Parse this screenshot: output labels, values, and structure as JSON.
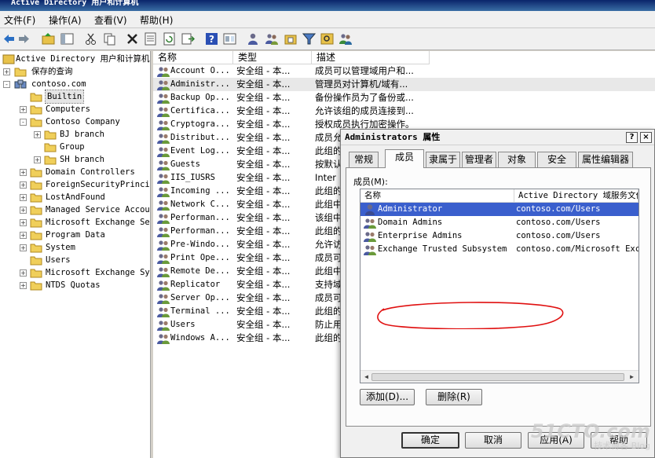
{
  "window": {
    "title": "Active Directory 用户和计算机"
  },
  "menu": [
    "文件(F)",
    "操作(A)",
    "查看(V)",
    "帮助(H)"
  ],
  "toolbar_icons": [
    "back-icon",
    "forward-icon",
    "up-folder-icon",
    "show-tree-icon",
    "cut-icon",
    "copy-icon",
    "delete-icon",
    "properties-icon",
    "refresh-icon",
    "export-icon",
    "help-icon",
    "mmc-icon",
    "new-user-icon",
    "new-group-icon",
    "new-ou-icon",
    "filter-icon",
    "find-icon",
    "add-to-group-icon"
  ],
  "tree": {
    "root": "Active Directory 用户和计算机",
    "saved_queries": "保存的查询",
    "domain": "contoso.com",
    "children": [
      {
        "label": "Builtin",
        "selected": true,
        "expander": "",
        "depth": 1
      },
      {
        "label": "Computers",
        "expander": "+",
        "depth": 1
      },
      {
        "label": "Contoso Company",
        "expander": "-",
        "depth": 1
      },
      {
        "label": "BJ branch",
        "expander": "+",
        "depth": 2
      },
      {
        "label": "Group",
        "expander": "",
        "depth": 2
      },
      {
        "label": "SH branch",
        "expander": "+",
        "depth": 2
      },
      {
        "label": "Domain Controllers",
        "expander": "+",
        "depth": 1
      },
      {
        "label": "ForeignSecurityPrincip",
        "expander": "+",
        "depth": 1
      },
      {
        "label": "LostAndFound",
        "expander": "+",
        "depth": 1
      },
      {
        "label": "Managed Service Accour",
        "expander": "+",
        "depth": 1
      },
      {
        "label": "Microsoft Exchange Sec",
        "expander": "+",
        "depth": 1
      },
      {
        "label": "Program Data",
        "expander": "+",
        "depth": 1
      },
      {
        "label": "System",
        "expander": "+",
        "depth": 1
      },
      {
        "label": "Users",
        "expander": "",
        "depth": 1
      },
      {
        "label": "Microsoft Exchange Sys",
        "expander": "+",
        "depth": 1
      },
      {
        "label": "NTDS Quotas",
        "expander": "+",
        "depth": 1
      }
    ]
  },
  "list": {
    "columns": [
      "名称",
      "类型",
      "描述"
    ],
    "rows": [
      {
        "name": "Account O...",
        "type": "安全组 - 本...",
        "desc": "成员可以管理域用户和..."
      },
      {
        "name": "Administr...",
        "type": "安全组 - 本...",
        "desc": "管理员对计算机/域有...",
        "selected": true
      },
      {
        "name": "Backup Op...",
        "type": "安全组 - 本...",
        "desc": "备份操作员为了备份或..."
      },
      {
        "name": "Certifica...",
        "type": "安全组 - 本...",
        "desc": "允许该组的成员连接到..."
      },
      {
        "name": "Cryptogra...",
        "type": "安全组 - 本...",
        "desc": "授权成员执行加密操作。"
      },
      {
        "name": "Distribut...",
        "type": "安全组 - 本...",
        "desc": "成员允"
      },
      {
        "name": "Event Log...",
        "type": "安全组 - 本...",
        "desc": "此组的"
      },
      {
        "name": "Guests",
        "type": "安全组 - 本...",
        "desc": "按默认"
      },
      {
        "name": "IIS_IUSRS",
        "type": "安全组 - 本...",
        "desc": "Inter"
      },
      {
        "name": "Incoming ...",
        "type": "安全组 - 本...",
        "desc": "此组的"
      },
      {
        "name": "Network C...",
        "type": "安全组 - 本...",
        "desc": "此组中"
      },
      {
        "name": "Performan...",
        "type": "安全组 - 本...",
        "desc": "该组中"
      },
      {
        "name": "Performan...",
        "type": "安全组 - 本...",
        "desc": "此组的"
      },
      {
        "name": "Pre-Windo...",
        "type": "安全组 - 本...",
        "desc": "允许访"
      },
      {
        "name": "Print Ope...",
        "type": "安全组 - 本...",
        "desc": "成员可"
      },
      {
        "name": "Remote De...",
        "type": "安全组 - 本...",
        "desc": "此组中"
      },
      {
        "name": "Replicator",
        "type": "安全组 - 本...",
        "desc": "支持域"
      },
      {
        "name": "Server Op...",
        "type": "安全组 - 本...",
        "desc": "成员可"
      },
      {
        "name": "Terminal ...",
        "type": "安全组 - 本...",
        "desc": "此组的"
      },
      {
        "name": "Users",
        "type": "安全组 - 本...",
        "desc": "防止用"
      },
      {
        "name": "Windows A...",
        "type": "安全组 - 本...",
        "desc": "此组的"
      }
    ]
  },
  "dialog": {
    "title": "Administrators 属性",
    "help_button": "?",
    "close_button": "×",
    "tabs": [
      "常规",
      "成员",
      "隶属于",
      "管理者",
      "对象",
      "安全",
      "属性编辑器"
    ],
    "active_tab": 1,
    "members_label": "成员(M):",
    "member_columns": [
      "名称",
      "Active Directory 域服务文件夹"
    ],
    "members": [
      {
        "name": "Administrator",
        "folder": "contoso.com/Users",
        "kind": "user",
        "selected": true
      },
      {
        "name": "Domain Admins",
        "folder": "contoso.com/Users",
        "kind": "group"
      },
      {
        "name": "Enterprise Admins",
        "folder": "contoso.com/Users",
        "kind": "group"
      },
      {
        "name": "Exchange Trusted Subsystem",
        "folder": "contoso.com/Microsoft Exchange Security Groups",
        "kind": "group"
      }
    ],
    "add_button": "添加(D)...",
    "remove_button": "删除(R)",
    "ok_button": "确定",
    "cancel_button": "取消",
    "apply_button": "应用(A)",
    "help_footer_button": "帮助"
  },
  "annotation": {
    "color": "#e01010"
  },
  "watermark": {
    "main": "51CTO.com",
    "sub": "技术博客 Blog"
  }
}
